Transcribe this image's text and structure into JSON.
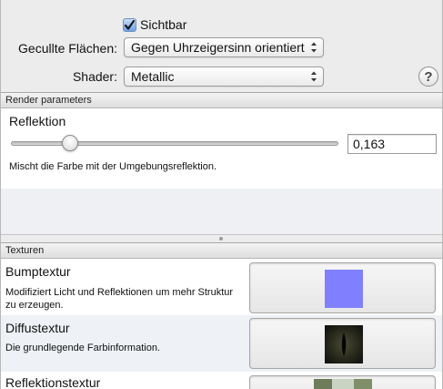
{
  "options": {
    "visible_label": "Sichtbar",
    "visible_checked": true,
    "culled_label": "Gecullte Flächen:",
    "culled_value": "Gegen Uhrzeigersinn orientiert",
    "shader_label": "Shader:",
    "shader_value": "Metallic",
    "help_symbol": "?"
  },
  "render": {
    "header": "Render parameters",
    "param_name": "Reflektion",
    "param_value": "0,163",
    "param_fraction": 0.163,
    "param_desc": "Mischt die Farbe mit der Umgebungsreflektion."
  },
  "textures": {
    "header": "Texturen",
    "items": [
      {
        "title": "Bumptextur",
        "desc": "Modifiziert Licht und Reflektionen um mehr Struktur zu erzeugen.",
        "swatch_color": "#8080ff"
      },
      {
        "title": "Diffustextur",
        "desc": "Die grundlegende Farbinformation.",
        "swatch_color": "#1f2119"
      },
      {
        "title": "Reflektionstextur",
        "desc": "",
        "swatch_color": "#8fa07a"
      }
    ]
  }
}
